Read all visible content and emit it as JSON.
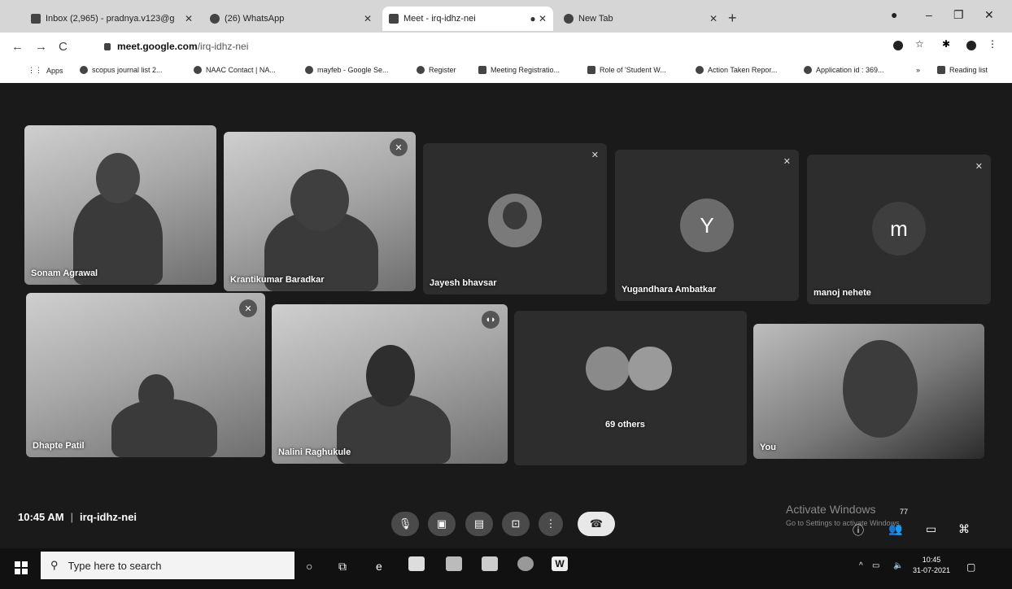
{
  "browser": {
    "tabs": [
      {
        "label": "Inbox (2,965) - pradnya.v123@g",
        "icon": "gmail-icon"
      },
      {
        "label": "(26) WhatsApp",
        "icon": "whatsapp-icon"
      },
      {
        "label": "Meet - irq-idhz-nei",
        "icon": "meet-icon"
      },
      {
        "label": "New Tab",
        "icon": "chrome-icon"
      }
    ],
    "active_tab": 2,
    "new_tab": "+",
    "url_host": "meet.google.com",
    "url_path": "/irq-idhz-nei",
    "bookmarks": [
      "Apps",
      "scopus journal list 2...",
      "NAAC Contact | NA...",
      "mayfeb - Google Se...",
      "Register",
      "Meeting Registratio...",
      "Role of 'Student W...",
      "Action Taken Repor...",
      "Application id : 369...",
      "»",
      "Reading list"
    ]
  },
  "meet": {
    "participants": [
      {
        "name": "Sonam Agrawal",
        "type": "video",
        "mic": "none"
      },
      {
        "name": "Krantikumar Baradkar",
        "type": "video",
        "mic": "muted"
      },
      {
        "name": "Jayesh bhavsar",
        "type": "photo",
        "mic": "muted"
      },
      {
        "name": "Yugandhara Ambatkar",
        "type": "initial",
        "initial": "Y",
        "mic": "muted"
      },
      {
        "name": "manoj nehete",
        "type": "initial",
        "initial": "m",
        "mic": "muted"
      },
      {
        "name": "Dhapte Patil",
        "type": "video",
        "mic": "muted"
      },
      {
        "name": "Nalini Raghukule",
        "type": "video",
        "mic": "speaking"
      },
      {
        "name": "69 others",
        "type": "group",
        "mic": "none"
      },
      {
        "name": "You",
        "type": "video",
        "mic": "none"
      }
    ],
    "time": "10:45 AM",
    "separator": "|",
    "meeting_code": "irq-idhz-nei",
    "people_count": "77",
    "colors": {
      "background": "#1a1a1a",
      "tile": "#2d2d2d",
      "avatar_y": "#6b6b6b",
      "avatar_m": "#3e3e3e"
    }
  },
  "watermark": {
    "title": "Activate Windows",
    "subtitle": "Go to Settings to activate Windows."
  },
  "taskbar": {
    "search_placeholder": "Type here to search",
    "clock_time": "10:45",
    "clock_date": "31-07-2021"
  }
}
